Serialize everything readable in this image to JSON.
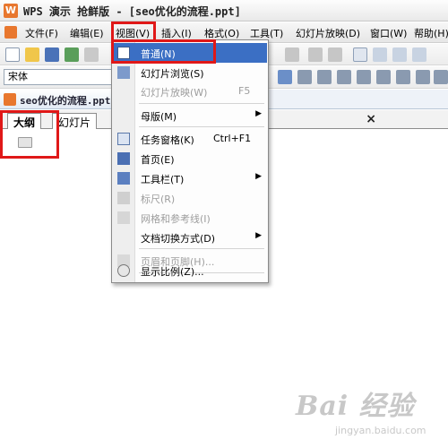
{
  "window": {
    "title": "WPS 演示 抢鲜版 - [seo优化的流程.ppt]"
  },
  "menubar": {
    "items": [
      {
        "label": "文件(F)"
      },
      {
        "label": "编辑(E)"
      },
      {
        "label": "视图(V)"
      },
      {
        "label": "插入(I)"
      },
      {
        "label": "格式(O)"
      },
      {
        "label": "工具(T)"
      },
      {
        "label": "幻灯片放映(D)"
      },
      {
        "label": "窗口(W)"
      },
      {
        "label": "帮助(H)"
      }
    ]
  },
  "toolbar": {
    "font_name": "宋体"
  },
  "document": {
    "tab_name": "seo优化的流程.ppt"
  },
  "panes": {
    "outline_tab": "大纲",
    "slides_tab": "幻灯片",
    "close_symbol": "×"
  },
  "view_menu": {
    "items": [
      {
        "label": "普通(N)",
        "shortcut": "",
        "icon": "normal-view-icon",
        "selected": true,
        "disabled": false,
        "submenu": false
      },
      {
        "label": "幻灯片浏览(S)",
        "shortcut": "",
        "icon": "slide-sorter-icon",
        "selected": false,
        "disabled": false,
        "submenu": false
      },
      {
        "label": "幻灯片放映(W)",
        "shortcut": "F5",
        "icon": "",
        "selected": false,
        "disabled": true,
        "submenu": false
      },
      {
        "label": "母版(M)",
        "shortcut": "",
        "icon": "",
        "selected": false,
        "disabled": false,
        "submenu": true
      },
      {
        "label": "任务窗格(K)",
        "shortcut": "Ctrl+F1",
        "icon": "task-pane-icon",
        "selected": false,
        "disabled": false,
        "submenu": false
      },
      {
        "label": "首页(E)",
        "shortcut": "",
        "icon": "home-page-icon",
        "selected": false,
        "disabled": false,
        "submenu": false
      },
      {
        "label": "工具栏(T)",
        "shortcut": "",
        "icon": "toolbar-icon",
        "selected": false,
        "disabled": false,
        "submenu": true
      },
      {
        "label": "标尺(R)",
        "shortcut": "",
        "icon": "ruler-icon",
        "selected": false,
        "disabled": true,
        "submenu": false
      },
      {
        "label": "网格和参考线(I)",
        "shortcut": "",
        "icon": "grid-icon",
        "selected": false,
        "disabled": true,
        "submenu": false
      },
      {
        "label": "文档切换方式(D)",
        "shortcut": "",
        "icon": "",
        "selected": false,
        "disabled": false,
        "submenu": true
      },
      {
        "label": "页眉和页脚(H)...",
        "shortcut": "",
        "icon": "header-footer-icon",
        "selected": false,
        "disabled": true,
        "submenu": false
      },
      {
        "label": "显示比例(Z)...",
        "shortcut": "",
        "icon": "zoom-icon",
        "selected": false,
        "disabled": false,
        "submenu": false
      }
    ]
  },
  "colors": {
    "highlight": "#e01818",
    "menu_selection": "#3b6fc4",
    "wps_orange": "#e8772e"
  },
  "watermark": {
    "brand": "Bai 经验",
    "url": "jingyan.baidu.com"
  }
}
